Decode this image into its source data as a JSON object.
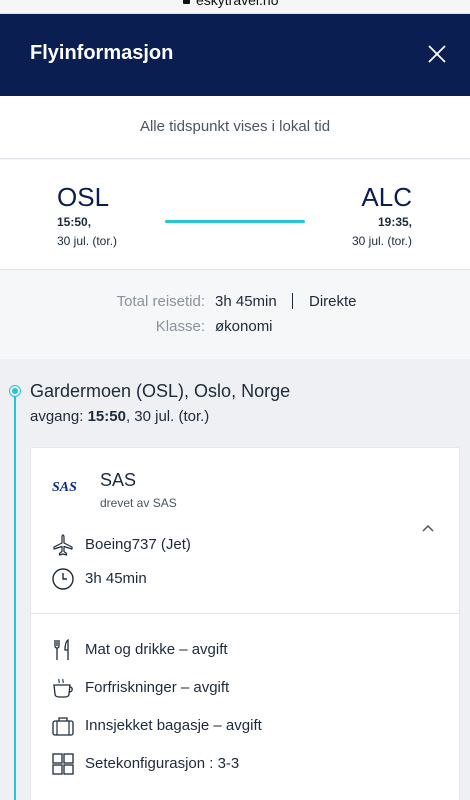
{
  "browser": {
    "url": "eskytravel.no"
  },
  "header": {
    "title": "Flyinformasjon"
  },
  "timezone_note": "Alle tidspunkt vises i lokal tid",
  "route": {
    "departure": {
      "code": "OSL",
      "time": "15:50,",
      "date": "30 jul. (tor.)"
    },
    "arrival": {
      "code": "ALC",
      "time": "19:35,",
      "date": "30 jul. (tor.)"
    }
  },
  "summary": {
    "total_label": "Total reisetid:",
    "total_value": "3h 45min",
    "stops_value": "Direkte",
    "class_label": "Klasse:",
    "class_value": "økonomi"
  },
  "segment": {
    "airport": "Gardermoen (OSL), Oslo, Norge",
    "departure_label": "avgang:",
    "departure_time": "15:50",
    "departure_date": ", 30 jul. (tor.)",
    "airline": "SAS",
    "logo_text": "SAS",
    "operated_by": "drevet av SAS",
    "aircraft": "Boeing737 (Jet)",
    "duration": "3h 45min",
    "amenities": [
      {
        "icon": "fork-knife-icon",
        "label": "Mat og drikke – avgift"
      },
      {
        "icon": "coffee-cup-icon",
        "label": "Forfriskninger – avgift"
      },
      {
        "icon": "luggage-icon",
        "label": "Innsjekket bagasje – avgift"
      },
      {
        "icon": "seat-grid-icon",
        "label": "Setekonfigurasjon : 3-3"
      }
    ]
  },
  "colors": {
    "header_bg": "#0b1e52",
    "accent": "#25c4d8",
    "sas_blue": "#0b2d8a"
  }
}
